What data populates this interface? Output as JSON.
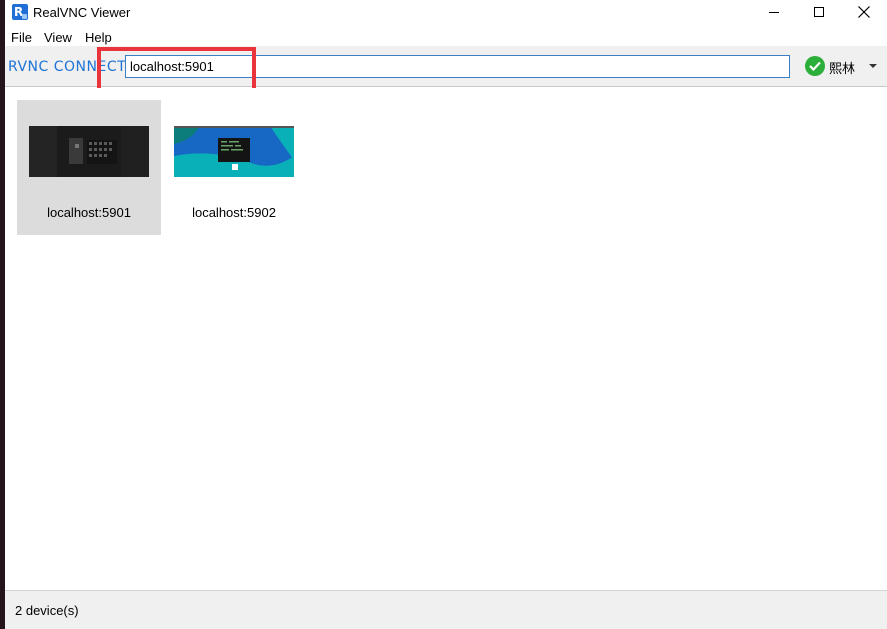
{
  "window": {
    "title": "RealVNC Viewer",
    "app_icon": "realvnc-app-icon"
  },
  "menu": {
    "file": "File",
    "view": "View",
    "help": "Help"
  },
  "toolbar": {
    "brand": "RVNC CONNECT",
    "address_value": "localhost:5901",
    "user_name": "熙林",
    "status_icon": "green-check-icon",
    "accent_color": "#1e73d6",
    "highlight_color": "#e8343a"
  },
  "devices": [
    {
      "label": "localhost:5901",
      "selected": true
    },
    {
      "label": "localhost:5902",
      "selected": false
    }
  ],
  "statusbar": {
    "device_count": "2 device(s)"
  }
}
